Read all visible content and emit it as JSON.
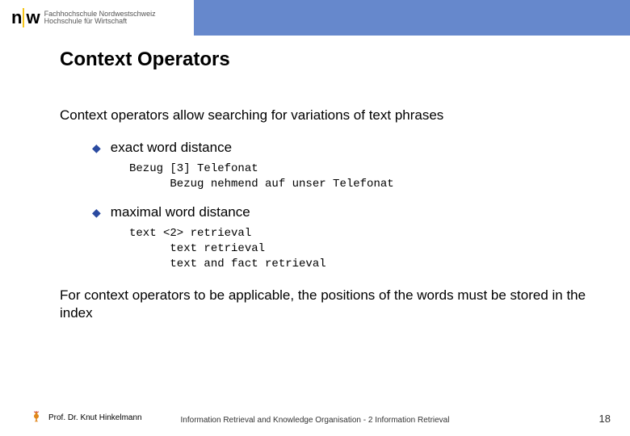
{
  "header": {
    "logo_line1": "Fachhochschule Nordwestschweiz",
    "logo_line2": "Hochschule für Wirtschaft"
  },
  "title": "Context Operators",
  "intro": "Context operators allow searching for variations of text phrases",
  "bullets": [
    {
      "label": "exact word distance",
      "code": "Bezug [3] Telefonat\n      Bezug nehmend auf unser Telefonat"
    },
    {
      "label": "maximal word distance",
      "code": "text <2> retrieval\n      text retrieval\n      text and fact retrieval"
    }
  ],
  "outro": "For context operators to be applicable, the positions of the words must be stored in the index",
  "footer": {
    "author": "Prof. Dr. Knut Hinkelmann",
    "center": "Information Retrieval and Knowledge Organisation - 2 Information Retrieval",
    "page": "18"
  }
}
